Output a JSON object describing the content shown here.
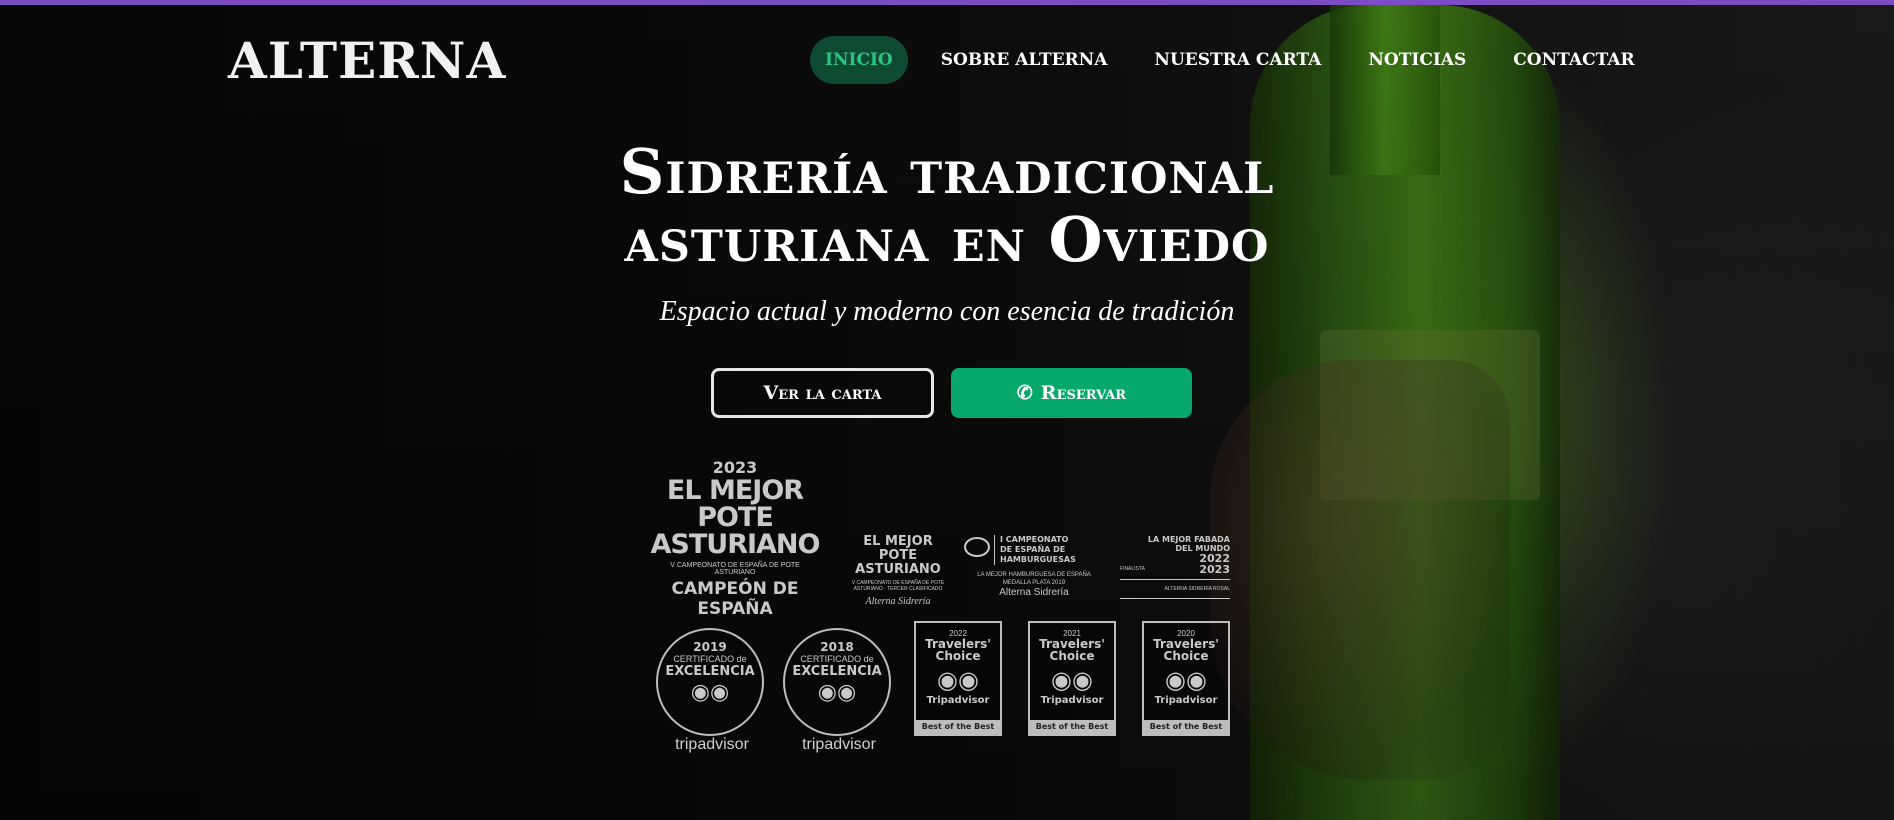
{
  "brand": {
    "logo_text": "ALTERNA"
  },
  "nav": {
    "items": [
      {
        "label": "INICIO"
      },
      {
        "label": "SOBRE ALTERNA"
      },
      {
        "label": "NUESTRA CARTA"
      },
      {
        "label": "NOTICIAS"
      },
      {
        "label": "CONTACTAR"
      }
    ],
    "active_color": "#27c981"
  },
  "hero": {
    "title_line1": "Sidrería tradicional",
    "title_line2": "asturiana en Oviedo",
    "subtitle": "Espacio actual y moderno con esencia de tradición",
    "btn_carta": "Ver la carta",
    "btn_reservar": "Reservar",
    "btn_reservar_icon": "phone-icon",
    "accent_color": "#07a86b"
  },
  "awards": {
    "pote_2023": {
      "year": "2023",
      "line1": "EL MEJOR",
      "line2": "POTE",
      "line3": "ASTURIANO",
      "small": "V CAMPEONATO DE ESPAÑA DE POTE ASTURIANO",
      "champ": "CAMPEÓN DE ESPAÑA"
    },
    "pote_small": {
      "line1": "EL MEJOR",
      "line2": "POTE ASTURIANO",
      "small": "V CAMPEONATO DE ESPAÑA DE POTE ASTURIANO · TERCER CLASIFICADO",
      "sign": "Alterna Sidrería"
    },
    "burger": {
      "line1": "I CAMPEONATO",
      "line2": "DE ESPAÑA DE",
      "line3": "HAMBURGUESAS",
      "sub1": "LA MEJOR HAMBURGUESA DE ESPAÑA",
      "sub2": "MEDALLA PLATA 2019",
      "sign": "Alterna Sidrería"
    },
    "fabada": {
      "line1": "LA MEJOR FABADA",
      "line2": "DEL MUNDO",
      "years1": "2022",
      "years2": "2023",
      "finalista": "FINALISTA",
      "rosal": "ALTERNA SIDRERÍA ROSAL"
    },
    "certificates": [
      {
        "year": "2019",
        "line1": "CERTIFICADO de",
        "line2": "EXCELENCIA",
        "brand": "tripadvisor"
      },
      {
        "year": "2018",
        "line1": "CERTIFICADO de",
        "line2": "EXCELENCIA",
        "brand": "tripadvisor"
      }
    ],
    "travelers_choice": [
      {
        "year": "2022",
        "title1": "Travelers'",
        "title2": "Choice",
        "brand": "Tripadvisor",
        "badge": "Best of the Best"
      },
      {
        "year": "2021",
        "title1": "Travelers'",
        "title2": "Choice",
        "brand": "Tripadvisor",
        "badge": "Best of the Best"
      },
      {
        "year": "2020",
        "title1": "Travelers'",
        "title2": "Choice",
        "brand": "Tripadvisor",
        "badge": "Best of the Best"
      }
    ]
  }
}
